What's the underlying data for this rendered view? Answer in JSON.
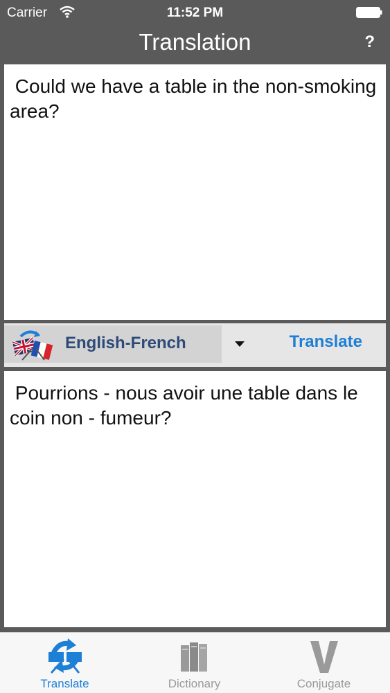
{
  "status_bar": {
    "carrier": "Carrier",
    "time": "11:52 PM"
  },
  "nav": {
    "title": "Translation",
    "help_label": "?"
  },
  "source_text": " Could we have a table in the non-smoking area?",
  "language_pair": "English-French",
  "translate_label": "Translate",
  "target_text": " Pourrions - nous avoir une table dans le coin non - fumeur?",
  "tabs": [
    {
      "label": "Translate",
      "icon": "translate-icon",
      "active": true
    },
    {
      "label": "Dictionary",
      "icon": "dictionary-icon",
      "active": false
    },
    {
      "label": "Conjugate",
      "icon": "conjugate-icon",
      "active": false
    }
  ],
  "colors": {
    "nav_bg": "#5a5a5a",
    "accent": "#1e7fd6",
    "lang_text": "#2d4a78"
  }
}
